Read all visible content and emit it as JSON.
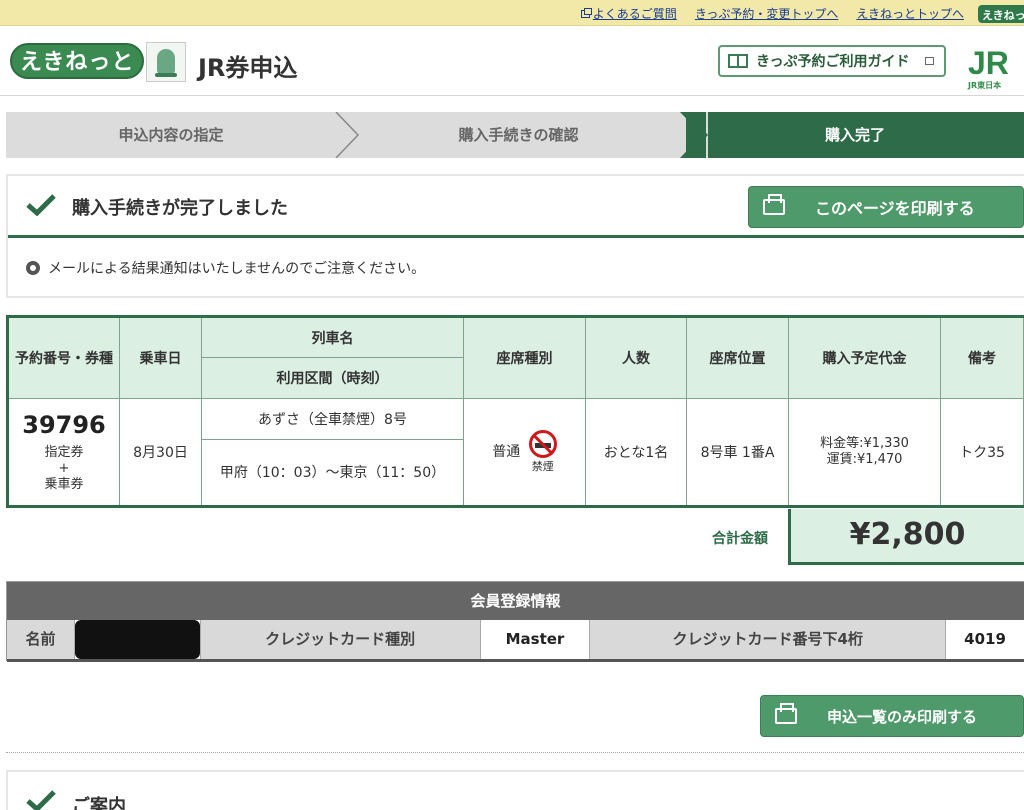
{
  "top_links": [
    {
      "label": "よくあるご質問"
    },
    {
      "label": "きっぷ予約・変更トップへ"
    },
    {
      "label": "えきねっとトップへ"
    }
  ],
  "top_badge": "えきねっと",
  "header": {
    "logo": "えきねっと",
    "title": "JR券申込",
    "guide_button": "きっぷ予約ご利用ガイド",
    "jr_mark": "JR",
    "jr_sub": "JR東日本"
  },
  "steps": [
    {
      "label": "申込内容の指定",
      "state": "done"
    },
    {
      "label": "購入手続きの確認",
      "state": "done"
    },
    {
      "label": "購入完了",
      "state": "current"
    }
  ],
  "done": {
    "title": "購入手続きが完了しました",
    "print_button": "このページを印刷する",
    "notice": "メールによる結果通知はいたしませんのでご注意ください。"
  },
  "ticket": {
    "headers": {
      "resv": "予約番号・券種",
      "date": "乗車日",
      "train": "列車名",
      "section": "利用区間（時刻）",
      "seat_type": "座席種別",
      "people": "人数",
      "seat_pos": "座席位置",
      "price": "購入予定代金",
      "remarks": "備考"
    },
    "row": {
      "resv_no": "39796",
      "ticket_type_1": "指定券",
      "ticket_type_2": "+",
      "ticket_type_3": "乗車券",
      "date": "8月30日",
      "train": "あずさ（全車禁煙）8号",
      "section": "甲府（10：03）〜東京（11：50）",
      "seat_type": "普通",
      "smoking": "禁煙",
      "people": "おとな1名",
      "seat_pos": "8号車 1番A",
      "fee": "料金等:¥1,330",
      "fare": "運賃:¥1,470",
      "remarks": "トク35"
    }
  },
  "total": {
    "label": "合計金額",
    "amount": "¥2,800"
  },
  "member": {
    "title": "会員登録情報",
    "name_label": "名前",
    "card_type_label": "クレジットカード種別",
    "card_type": "Master",
    "card_last4_label": "クレジットカード番号下4桁",
    "card_last4": "4019"
  },
  "print_list_button": "申込一覧のみ印刷する",
  "info": {
    "title": "ご案内"
  },
  "colors": {
    "accent": "#2e6b49",
    "button": "#4f9a6a",
    "header_cell": "#dcefe3",
    "topbar": "#f2e8a8"
  }
}
